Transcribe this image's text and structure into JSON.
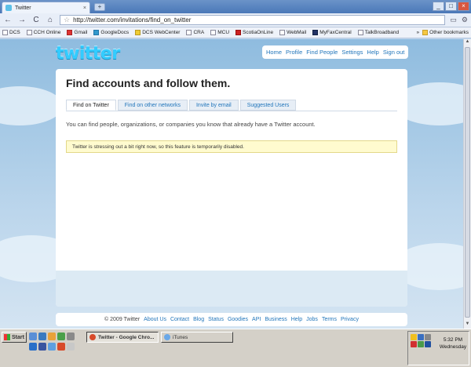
{
  "browser": {
    "tab_title": "Twitter",
    "tab_close": "×",
    "new_tab": "+",
    "url": "http://twitter.com/invitations/find_on_twitter",
    "nav": {
      "back": "←",
      "forward": "→",
      "reload": "C",
      "home": "⌂",
      "star": "☆"
    },
    "window": {
      "minimize": "_",
      "maximize": "□",
      "close": "×"
    },
    "bookmarks": [
      "DCS",
      "CCH Online",
      "Gmail",
      "GoogleDocs",
      "DCS WebCenter",
      "CRA",
      "MCU",
      "ScotiaOnLine",
      "WebMail",
      "MyFaxCentral",
      "TalkBroadband"
    ],
    "more_bookmarks": "»",
    "other_bookmarks": "Other bookmarks"
  },
  "page": {
    "logo": "twitter",
    "topnav": [
      "Home",
      "Profile",
      "Find People",
      "Settings",
      "Help",
      "Sign out"
    ],
    "heading": "Find accounts and follow them.",
    "tabs": [
      "Find on Twitter",
      "Find on other networks",
      "Invite by email",
      "Suggested Users"
    ],
    "description": "You can find people, organizations, or companies you know that already have a Twitter account.",
    "alert": "Twitter is stressing out a bit right now, so this feature is temporarily disabled.",
    "footer": {
      "copyright": "© 2009 Twitter",
      "links": [
        "About Us",
        "Contact",
        "Blog",
        "Status",
        "Goodies",
        "API",
        "Business",
        "Help",
        "Jobs",
        "Terms",
        "Privacy"
      ]
    }
  },
  "taskbar": {
    "start": "Start",
    "windows": [
      "Twitter - Google Chro...",
      "iTunes"
    ],
    "time": "5:32 PM",
    "day": "Wednesday"
  },
  "colors": {
    "link": "#2276bb",
    "logo": "#33ccff",
    "alert_bg": "#fffbcf"
  }
}
